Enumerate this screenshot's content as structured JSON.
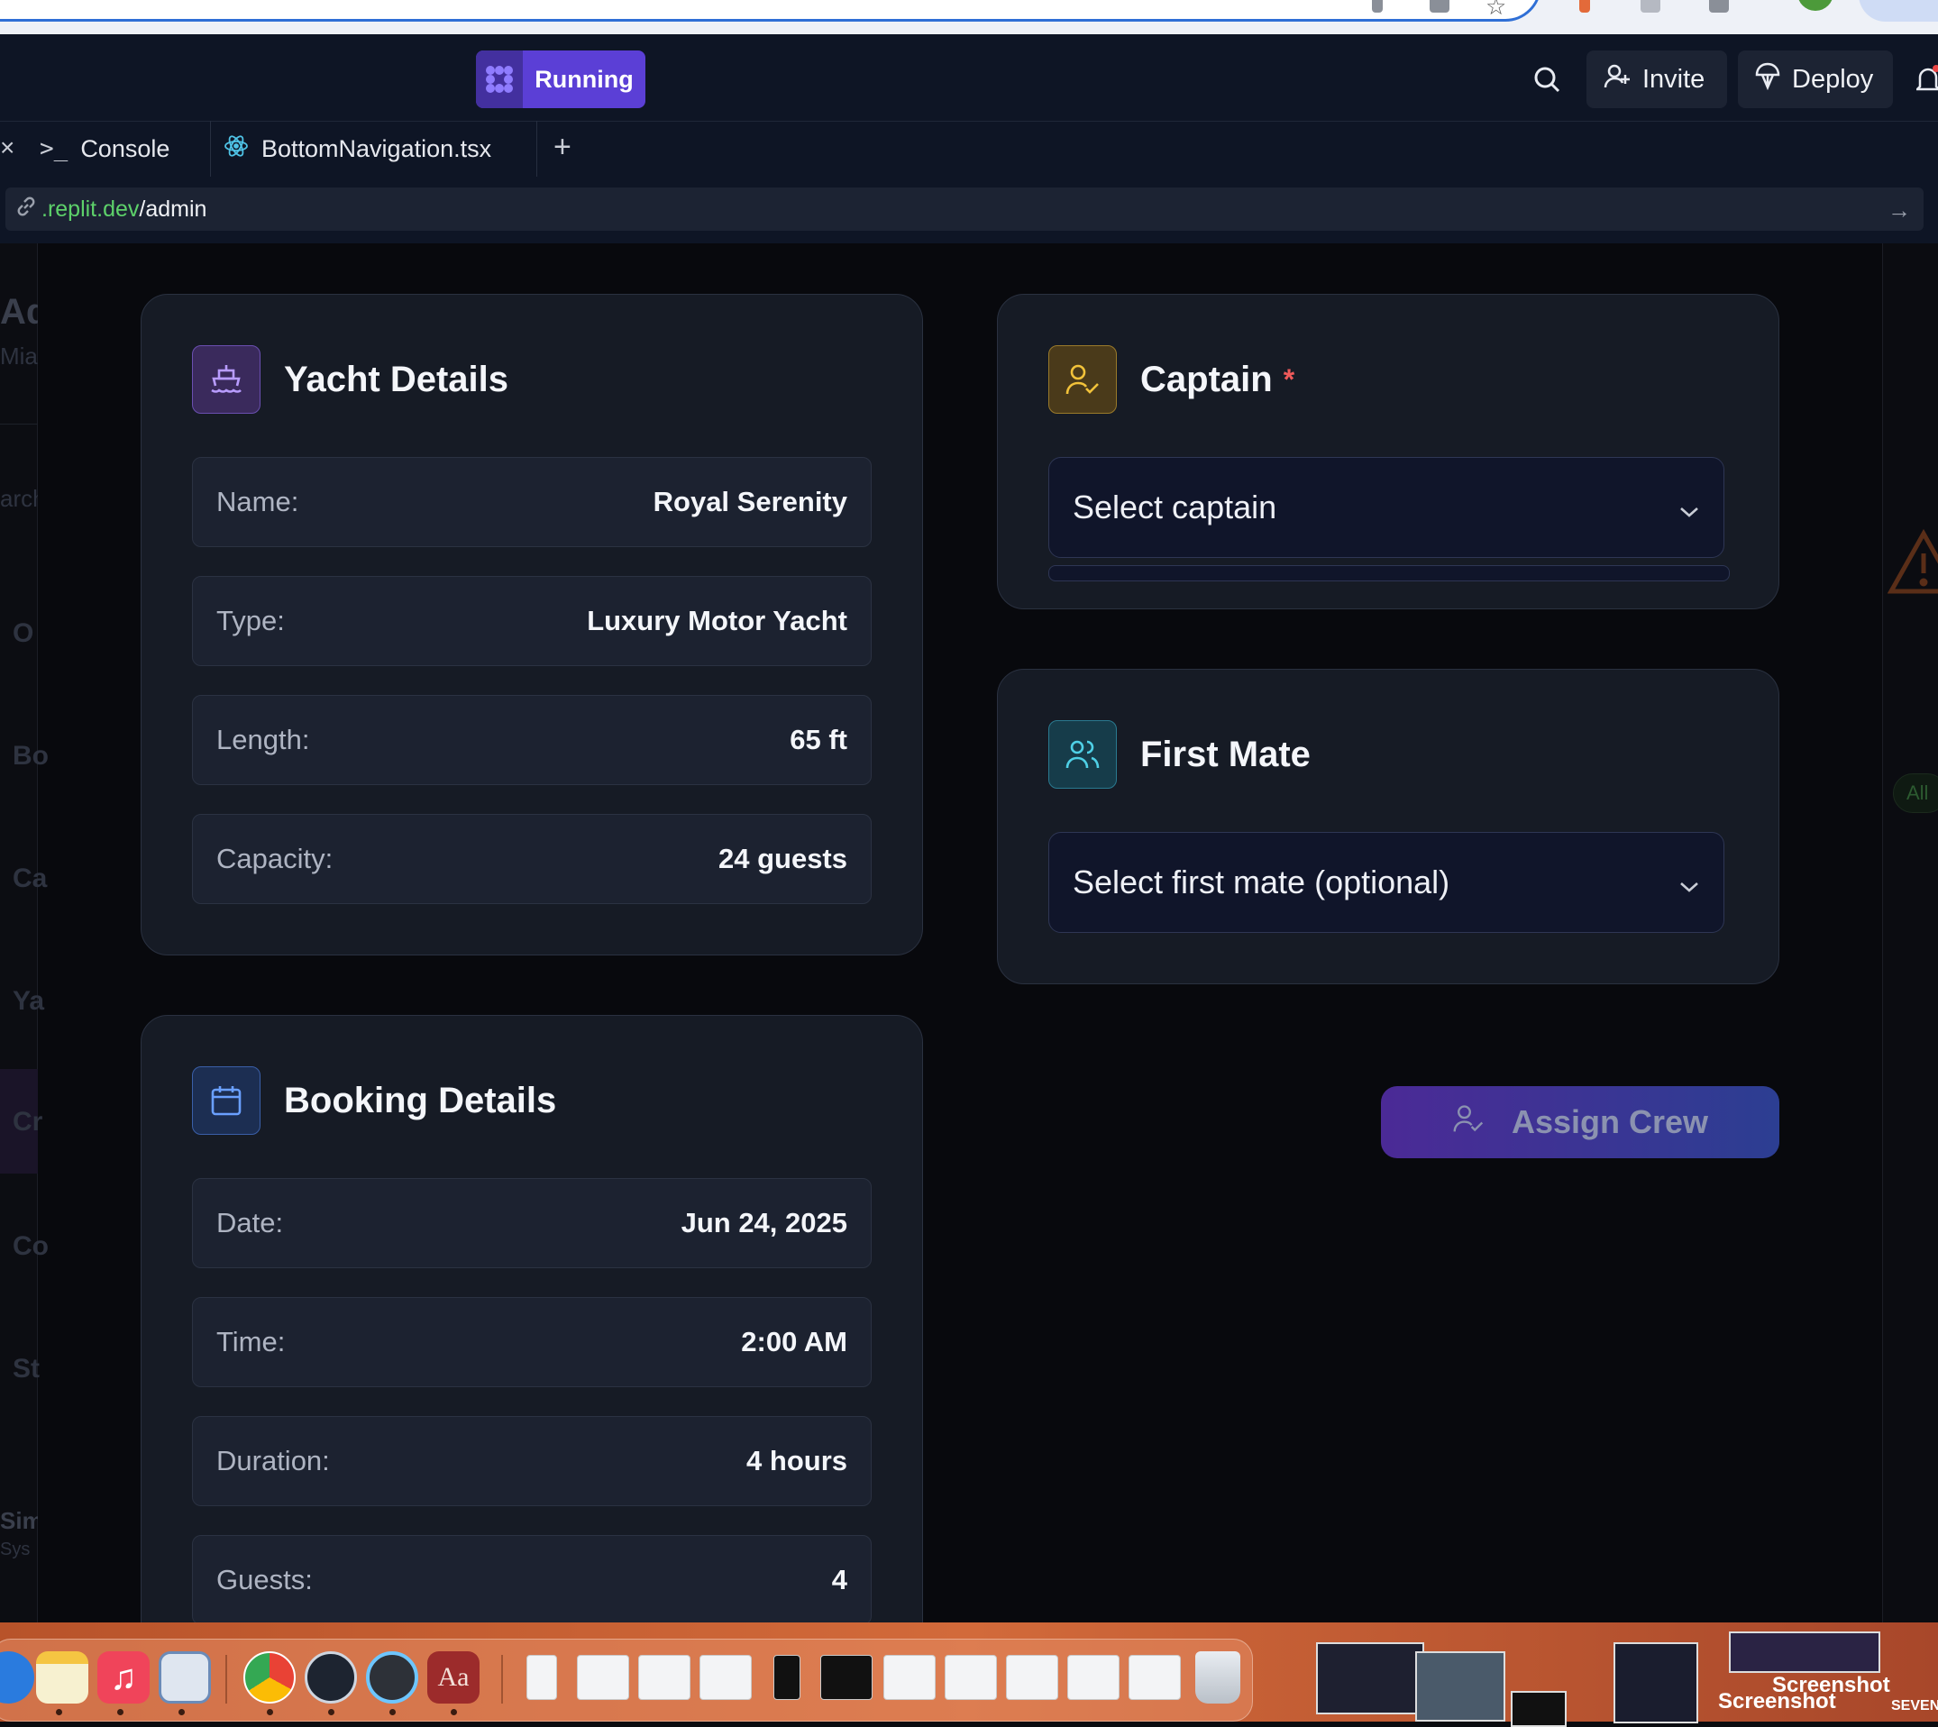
{
  "browser": {
    "icons": [
      "extension-icon",
      "media-icon",
      "bookmark-star-icon",
      "flag-icon",
      "tab-icon",
      "window-icon"
    ]
  },
  "header": {
    "run_status": "Running",
    "invite_label": "Invite",
    "deploy_label": "Deploy"
  },
  "tabs": [
    {
      "label": "Console",
      "icon": "console-icon"
    },
    {
      "label": "BottomNavigation.tsx",
      "icon": "react-icon"
    }
  ],
  "url": {
    "domain": ".replit.dev",
    "path": "/admin"
  },
  "left_strip": [
    "Ad",
    "Mia",
    "arch",
    "O",
    "Bo",
    "Ca",
    "Ya",
    "Cr",
    "Co",
    "St",
    "Sim",
    "Sys"
  ],
  "right_strip": {
    "badge": "All"
  },
  "yacht_card": {
    "title": "Yacht Details",
    "rows": [
      {
        "label": "Name:",
        "value": "Royal Serenity"
      },
      {
        "label": "Type:",
        "value": "Luxury Motor Yacht"
      },
      {
        "label": "Length:",
        "value": "65 ft"
      },
      {
        "label": "Capacity:",
        "value": "24 guests"
      }
    ]
  },
  "booking_card": {
    "title": "Booking Details",
    "rows": [
      {
        "label": "Date:",
        "value": "Jun 24, 2025"
      },
      {
        "label": "Time:",
        "value": "2:00 AM"
      },
      {
        "label": "Duration:",
        "value": "4 hours"
      },
      {
        "label": "Guests:",
        "value": "4"
      }
    ]
  },
  "captain_card": {
    "title": "Captain",
    "required_mark": "*",
    "placeholder": "Select captain"
  },
  "firstmate_card": {
    "title": "First Mate",
    "placeholder": "Select first mate (optional)"
  },
  "assign_button": {
    "label": "Assign Crew"
  },
  "dock": {
    "apps": [
      "safari-icon",
      "notes-icon",
      "music-icon",
      "preview-icon",
      "chrome-icon",
      "instruments-icon",
      "quicktime-icon",
      "dictionary-icon"
    ],
    "dictionary_glyph": "Aa",
    "screenshot_labels": [
      "Screenshot",
      "Screenshot",
      "SEVEN"
    ]
  },
  "colors": {
    "run_chip": "#5b3fd6",
    "yacht_icon_bg": "#3a2a5c",
    "captain_icon_bg": "#4a3a1a",
    "firstmate_icon_bg": "#163c4a",
    "booking_icon_bg": "#1c2e52",
    "required": "#ef5a5a",
    "url_domain": "#5dd16a"
  }
}
